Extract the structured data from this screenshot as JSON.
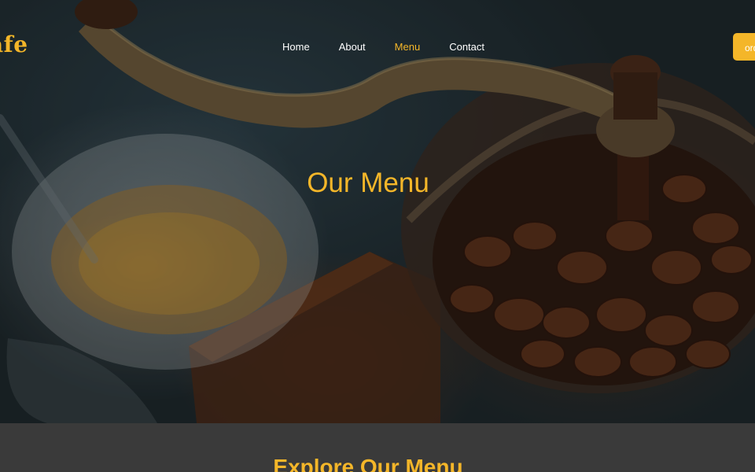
{
  "brand": {
    "name": "afe"
  },
  "nav": {
    "items": [
      {
        "label": "Home",
        "active": false
      },
      {
        "label": "About",
        "active": false
      },
      {
        "label": "Menu",
        "active": true
      },
      {
        "label": "Contact",
        "active": false
      }
    ],
    "order_button_label": "order"
  },
  "hero": {
    "title": "Our Menu"
  },
  "section": {
    "title": "Explore Our Menu"
  },
  "colors": {
    "accent": "#f4b629",
    "section_bg": "#3a3a3a",
    "nav_text": "#ffffff"
  },
  "icons": {
    "hero_image": "coffee-grinder-photo"
  }
}
